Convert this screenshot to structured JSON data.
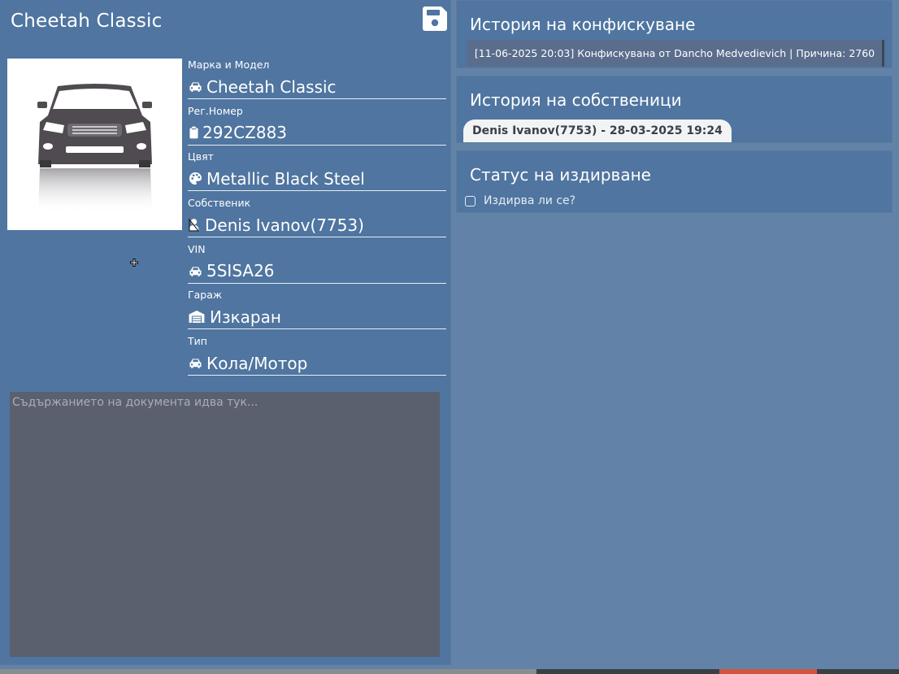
{
  "vehicle": {
    "title": "Cheetah Classic"
  },
  "fields": [
    {
      "label": "Марка и Модел",
      "value": "Cheetah Classic",
      "icon": "car-icon"
    },
    {
      "label": "Рег.Номер",
      "value": "292CZ883",
      "icon": "clipboard-icon"
    },
    {
      "label": "Цвят",
      "value": "Metallic Black Steel",
      "icon": "palette-icon"
    },
    {
      "label": "Собственик",
      "value": "Denis Ivanov(7753)",
      "icon": "user-icon"
    },
    {
      "label": "VIN",
      "value": "5SISA26",
      "icon": "car-icon"
    },
    {
      "label": "Гараж",
      "value": "Изкаран",
      "icon": "warehouse-icon"
    },
    {
      "label": "Тип",
      "value": "Кола/Мотор",
      "icon": "car-icon"
    }
  ],
  "notes": {
    "placeholder": "Съдържанието на документа идва тук..."
  },
  "confiscation": {
    "title": "История на конфискуване",
    "entries": [
      "[11-06-2025 20:03] Конфискувана от Dancho Medvedievich | Причина: 2760"
    ]
  },
  "owners": {
    "title": "История на собственици",
    "entries": [
      "Denis Ivanov(7753) - 28-03-2025 19:24"
    ]
  },
  "wanted": {
    "title": "Статус на издирване",
    "checkbox_label": "Издирва ли се?",
    "checked": false
  }
}
